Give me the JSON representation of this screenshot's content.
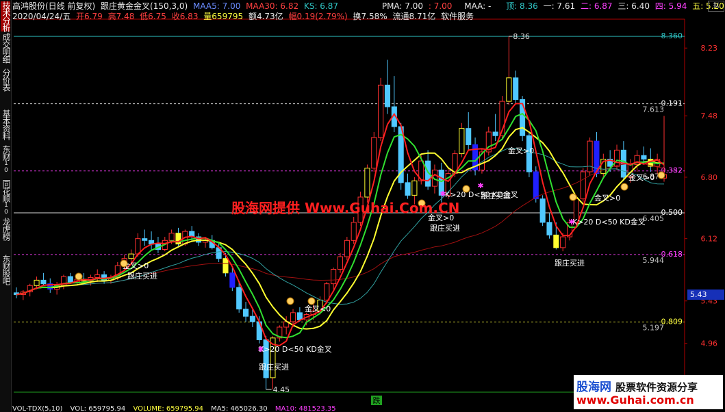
{
  "sidebar": [
    {
      "label": "技术分析",
      "sub": "",
      "active": true
    },
    {
      "label": "成交明细",
      "sub": ""
    },
    {
      "label": "分价表",
      "sub": ""
    },
    {
      "label": "基本资料",
      "sub": ""
    },
    {
      "label": "东财",
      "sub": "10"
    },
    {
      "label": "同花顺",
      "sub": "10"
    },
    {
      "label": "龙虎榜",
      "sub": ""
    },
    {
      "label": "东财股吧",
      "sub": ""
    }
  ],
  "header": {
    "stock": "高鸿股份(日线 前复权)",
    "indicator": "跟庄黄金金叉(150,3,0)",
    "maa5": "MAA5: 7.00",
    "maa30": "MAA30: 6.82",
    "ks": "KS: 6.87",
    "pma": "PMA: 7.00",
    "pma2": ": 7.00",
    "maa": "MAA: -",
    "ding": "顶: 8.36",
    "l1": "一: 7.61",
    "l2": "二: 6.87",
    "l3": "三: 6.40",
    "l4": "四: 5.94",
    "l5": "五: 5.20",
    "date": "2020/04/24/五",
    "open": "开6.79",
    "high": "高7.48",
    "low": "低6.75",
    "close": "收6.83",
    "vol": "量659795",
    "amount": "额4.73亿",
    "change": "幅0.19(2.79%)",
    "turnover": "换7.58%",
    "float": "流通8.71亿",
    "sector": "软件服务"
  },
  "top_right_label": "拟",
  "cursor_price": "5.43",
  "watermark": "股海网提供 Www.Guhai.Com.CN",
  "logo": {
    "line1": "股海网",
    "slogan": "股票软件资源分享",
    "line2": "www.Guhai.com.cn"
  },
  "footer": {
    "vol": "VOL-TDX(5,10)",
    "vol_val": "VOL: 659795.94",
    "volume": "VOLUME: 659795.94",
    "ma5": "MA5: 465026.30",
    "ma10": "MA10: 481523.35"
  },
  "footer_badge": "跌",
  "chart_data": {
    "type": "candlestick",
    "y_ticks": [
      8.23,
      7.48,
      6.8,
      6.12,
      5.43,
      4.96
    ],
    "ylim": [
      4.42,
      8.55
    ],
    "candles": [
      [
        5.52,
        5.58,
        5.46,
        5.5
      ],
      [
        5.5,
        5.55,
        5.44,
        5.53
      ],
      [
        5.53,
        5.62,
        5.48,
        5.6
      ],
      [
        5.6,
        5.7,
        5.56,
        5.66
      ],
      [
        5.66,
        5.74,
        5.6,
        5.62
      ],
      [
        5.62,
        5.68,
        5.52,
        5.56
      ],
      [
        5.56,
        5.64,
        5.5,
        5.6
      ],
      [
        5.6,
        5.72,
        5.56,
        5.7
      ],
      [
        5.7,
        5.74,
        5.62,
        5.64
      ],
      [
        5.64,
        5.7,
        5.6,
        5.67
      ],
      [
        5.67,
        5.74,
        5.62,
        5.65
      ],
      [
        5.65,
        5.72,
        5.6,
        5.69
      ],
      [
        5.69,
        5.78,
        5.64,
        5.72
      ],
      [
        5.72,
        5.76,
        5.62,
        5.66
      ],
      [
        5.66,
        5.72,
        5.62,
        5.69
      ],
      [
        5.69,
        5.86,
        5.66,
        5.82
      ],
      [
        5.82,
        5.94,
        5.78,
        5.9
      ],
      [
        5.9,
        6.0,
        5.84,
        5.95
      ],
      [
        5.95,
        6.18,
        5.92,
        6.12
      ],
      [
        6.12,
        6.22,
        6.04,
        6.1
      ],
      [
        6.1,
        6.2,
        6.0,
        6.06
      ],
      [
        6.06,
        6.14,
        5.96,
        6.0
      ],
      [
        6.0,
        6.14,
        5.98,
        6.1
      ],
      [
        6.1,
        6.22,
        6.06,
        6.18
      ],
      [
        6.18,
        6.24,
        6.04,
        6.06
      ],
      [
        6.06,
        6.22,
        6.04,
        6.2
      ],
      [
        6.2,
        6.26,
        6.1,
        6.14
      ],
      [
        6.14,
        6.18,
        6.04,
        6.08
      ],
      [
        6.08,
        6.14,
        6.02,
        6.1
      ],
      [
        6.1,
        6.16,
        6.0,
        6.02
      ],
      [
        6.02,
        6.08,
        5.86,
        5.9
      ],
      [
        5.9,
        5.96,
        5.7,
        5.74
      ],
      [
        5.74,
        5.8,
        5.54,
        5.58
      ],
      [
        5.58,
        5.64,
        5.3,
        5.34
      ],
      [
        5.34,
        5.42,
        5.2,
        5.26
      ],
      [
        5.26,
        5.34,
        5.14,
        5.2
      ],
      [
        5.2,
        5.26,
        4.96,
        5.0
      ],
      [
        5.0,
        5.04,
        4.45,
        4.58
      ],
      [
        4.58,
        5.04,
        4.45,
        5.02
      ],
      [
        5.02,
        5.16,
        4.98,
        5.14
      ],
      [
        5.14,
        5.26,
        5.06,
        5.2
      ],
      [
        5.2,
        5.34,
        5.14,
        5.3
      ],
      [
        5.3,
        5.36,
        5.2,
        5.22
      ],
      [
        5.22,
        5.3,
        5.16,
        5.28
      ],
      [
        5.28,
        5.4,
        5.22,
        5.32
      ],
      [
        5.32,
        5.48,
        5.28,
        5.44
      ],
      [
        5.44,
        5.64,
        5.4,
        5.62
      ],
      [
        5.62,
        5.8,
        5.56,
        5.78
      ],
      [
        5.78,
        5.96,
        5.74,
        5.92
      ],
      [
        5.92,
        6.14,
        5.88,
        6.1
      ],
      [
        6.1,
        6.36,
        6.06,
        6.3
      ],
      [
        6.3,
        6.64,
        6.26,
        6.58
      ],
      [
        6.58,
        6.94,
        6.52,
        6.9
      ],
      [
        6.9,
        7.3,
        6.86,
        7.24
      ],
      [
        7.24,
        7.9,
        7.2,
        7.82
      ],
      [
        7.82,
        8.1,
        7.5,
        7.58
      ],
      [
        7.58,
        7.92,
        7.3,
        7.36
      ],
      [
        7.36,
        7.4,
        6.66,
        6.74
      ],
      [
        6.74,
        6.84,
        6.56,
        6.6
      ],
      [
        6.6,
        6.8,
        6.5,
        6.76
      ],
      [
        6.76,
        7.04,
        6.72,
        6.98
      ],
      [
        6.98,
        7.1,
        6.66,
        6.7
      ],
      [
        6.7,
        6.94,
        6.62,
        6.88
      ],
      [
        6.88,
        6.96,
        6.52,
        6.6
      ],
      [
        6.6,
        6.9,
        6.56,
        6.84
      ],
      [
        6.84,
        7.1,
        6.8,
        7.06
      ],
      [
        7.06,
        7.4,
        7.02,
        7.34
      ],
      [
        7.34,
        7.52,
        7.1,
        7.16
      ],
      [
        7.16,
        7.24,
        6.82,
        6.88
      ],
      [
        6.88,
        7.12,
        6.84,
        7.08
      ],
      [
        7.08,
        7.36,
        7.04,
        7.3
      ],
      [
        7.3,
        7.5,
        7.2,
        7.26
      ],
      [
        7.26,
        7.7,
        7.22,
        7.64
      ],
      [
        7.64,
        8.36,
        7.6,
        7.9
      ],
      [
        7.9,
        7.98,
        7.62,
        7.66
      ],
      [
        7.66,
        7.7,
        7.2,
        7.26
      ],
      [
        7.26,
        7.3,
        6.8,
        6.86
      ],
      [
        6.86,
        6.92,
        6.52,
        6.56
      ],
      [
        6.56,
        6.6,
        6.26,
        6.3
      ],
      [
        6.3,
        6.4,
        6.12,
        6.16
      ],
      [
        6.16,
        6.3,
        6.0,
        6.02
      ],
      [
        6.02,
        6.18,
        5.98,
        6.14
      ],
      [
        6.14,
        6.34,
        6.1,
        6.3
      ],
      [
        6.3,
        6.6,
        6.26,
        6.56
      ],
      [
        6.56,
        6.9,
        6.52,
        6.86
      ],
      [
        6.86,
        7.24,
        6.82,
        7.2
      ],
      [
        7.2,
        7.3,
        6.8,
        6.84
      ],
      [
        6.84,
        7.06,
        6.8,
        7.0
      ],
      [
        7.0,
        7.1,
        6.86,
        6.92
      ],
      [
        6.92,
        7.16,
        6.88,
        7.1
      ],
      [
        7.1,
        7.2,
        6.76,
        6.8
      ],
      [
        6.8,
        7.0,
        6.74,
        6.94
      ],
      [
        6.94,
        7.1,
        6.86,
        7.04
      ],
      [
        7.04,
        7.14,
        6.94,
        7.0
      ],
      [
        7.0,
        7.12,
        6.86,
        6.92
      ],
      [
        6.92,
        7.06,
        6.84,
        7.0
      ],
      [
        6.79,
        7.48,
        6.75,
        6.83
      ]
    ],
    "level_lines": [
      {
        "name": "顶",
        "value": 8.36,
        "label": "8.360"
      },
      {
        "name": "一",
        "value": 7.613,
        "label": "0.191"
      },
      {
        "name": "二",
        "value": 6.87,
        "label": "0.382"
      },
      {
        "name": "三",
        "value": 6.405,
        "label": "0.500"
      },
      {
        "name": "四",
        "value": 5.944,
        "label": "0.618"
      },
      {
        "name": "五",
        "value": 5.197,
        "label": "0.809"
      }
    ],
    "high_label": "8.36",
    "low_label": "4.45",
    "annotations": [
      {
        "text": "金叉>0",
        "x": "right-of-bar-31"
      },
      {
        "text": "跟庄买进"
      },
      {
        "text": "金叉<0"
      },
      {
        "text": "K>20 D<50 KD金叉"
      },
      {
        "text": "跟庄买进"
      },
      {
        "text": "金叉>0"
      },
      {
        "text": "跟庄买进"
      },
      {
        "text": "K>20 D<50 KD金叉"
      },
      {
        "text": "跟庄买进"
      },
      {
        "text": "K>20 D<50 KD金叉"
      },
      {
        "text": "金叉>0"
      },
      {
        "text": "跟庄买进"
      },
      {
        "text": "金叉>0"
      },
      {
        "text": "金叉>0"
      }
    ]
  }
}
